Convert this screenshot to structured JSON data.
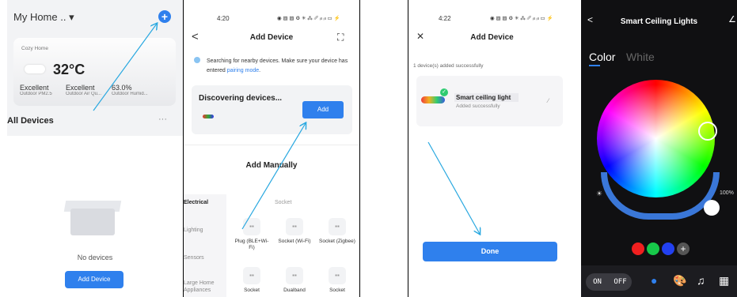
{
  "panel1": {
    "home_title": "My Home .. ▾",
    "add_icon": "+",
    "weather": {
      "location": "Cozy Home",
      "temperature": "32°C",
      "stats": [
        {
          "value": "Excellent",
          "label": "Outdoor PM2.5"
        },
        {
          "value": "Excellent",
          "label": "Outdoor Air Qu..."
        },
        {
          "value": "63.0%",
          "label": "Outdoor Humid..."
        }
      ]
    },
    "all_devices": "All Devices",
    "more": "···",
    "empty_text": "No devices",
    "add_device_button": "Add Device"
  },
  "panel2": {
    "time": "4:20",
    "status_icons": "◉ ▨ ▨ ⚙ ✳ ⁂ ␥ ᵢₗₗ ᵢₗₗ ▭ ⚡",
    "back": "<",
    "title": "Add Device",
    "scan_icon": "⛶",
    "info_text": "Searching for nearby devices. Make sure your device has entered ",
    "info_link": "pairing mode",
    "info_end": ".",
    "discovering": "Discovering devices...",
    "add_button": "Add",
    "add_manually": "Add Manually",
    "categories": [
      "Electrical",
      "Lighting",
      "Sensors",
      "Large Home Appliances"
    ],
    "socket_header": "Socket",
    "devices": [
      {
        "name": "Plug (BLE+Wi-Fi)"
      },
      {
        "name": "Socket (Wi-Fi)"
      },
      {
        "name": "Socket (Zigbee)"
      },
      {
        "name": "Socket"
      },
      {
        "name": "Dualband"
      },
      {
        "name": "Socket"
      }
    ]
  },
  "panel3": {
    "time": "4:22",
    "status_icons": "◉ ▨ ▨ ⚙ ✳ ⁂ ␥ ᵢₗₗ ᵢₗₗ ▭ ⚡",
    "close": "✕",
    "title": "Add Device",
    "added_text": "1 device(s) added successfully",
    "device_name": "Smart ceiling light",
    "device_status": "Added successfully",
    "done_button": "Done"
  },
  "panel4": {
    "back": "<",
    "title": "Smart Ceiling Lights",
    "edit_icon": "∠",
    "tab_color": "Color",
    "tab_white": "White",
    "brightness_icon": "☀",
    "brightness_pct": "100%",
    "swatches": [
      "#f01f1f",
      "#17c94a",
      "#2240f0"
    ],
    "swatch_add": "+",
    "on": "ON",
    "off": "OFF",
    "bottom_icons": [
      "●",
      "🎨",
      "♫",
      "▦"
    ]
  }
}
